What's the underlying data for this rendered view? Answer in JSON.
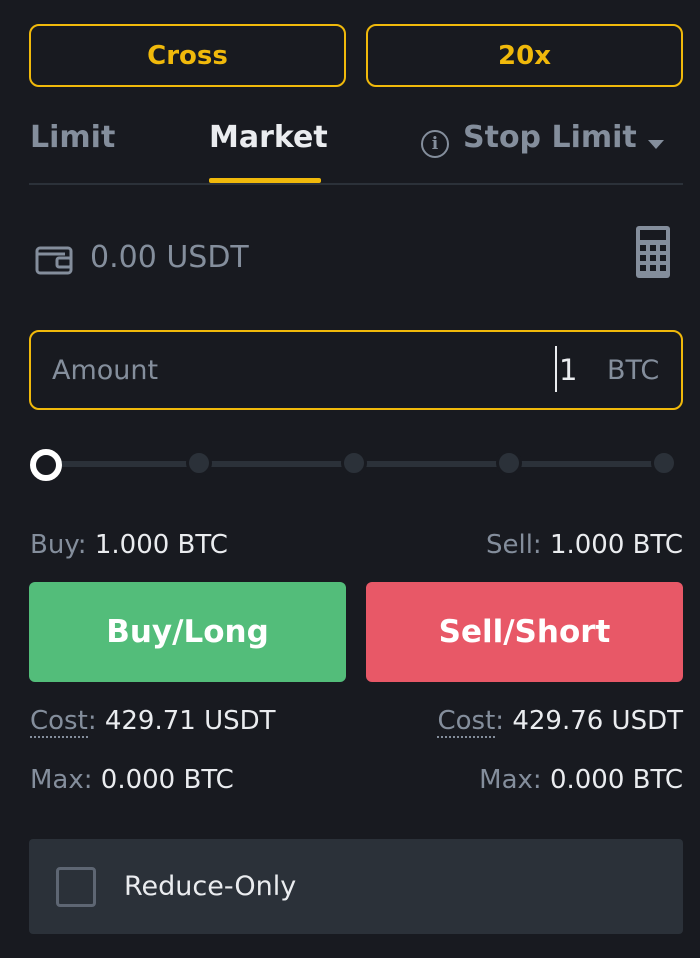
{
  "top": {
    "margin_mode": "Cross",
    "leverage": "20x"
  },
  "tabs": [
    {
      "label": "Limit",
      "active": false
    },
    {
      "label": "Market",
      "active": true
    },
    {
      "label": "Stop Limit",
      "active": false
    }
  ],
  "balance": {
    "text": "0.00 USDT"
  },
  "amount": {
    "placeholder": "Amount",
    "value": "1",
    "unit": "BTC"
  },
  "slider": {
    "level": 0
  },
  "buy": {
    "qty_label": "Buy:",
    "qty_value": "1.000 BTC",
    "button_label": "Buy/Long",
    "cost_label": "Cost",
    "cost_value": "429.71 USDT",
    "max_label": "Max:",
    "max_value": "0.000 BTC"
  },
  "sell": {
    "qty_label": "Sell:",
    "qty_value": "1.000 BTC",
    "button_label": "Sell/Short",
    "cost_label": "Cost",
    "cost_value": "429.76 USDT",
    "max_label": "Max:",
    "max_value": "0.000 BTC"
  },
  "reduce_only": {
    "label": "Reduce-Only",
    "checked": false
  },
  "colors": {
    "accent": "#f0b90b",
    "buy": "#53bd7a",
    "sell": "#e85867",
    "background": "#181a20",
    "muted": "#848e9c"
  },
  "icons": [
    "wallet-icon",
    "calculator-icon",
    "info-icon",
    "chevron-down-icon"
  ]
}
